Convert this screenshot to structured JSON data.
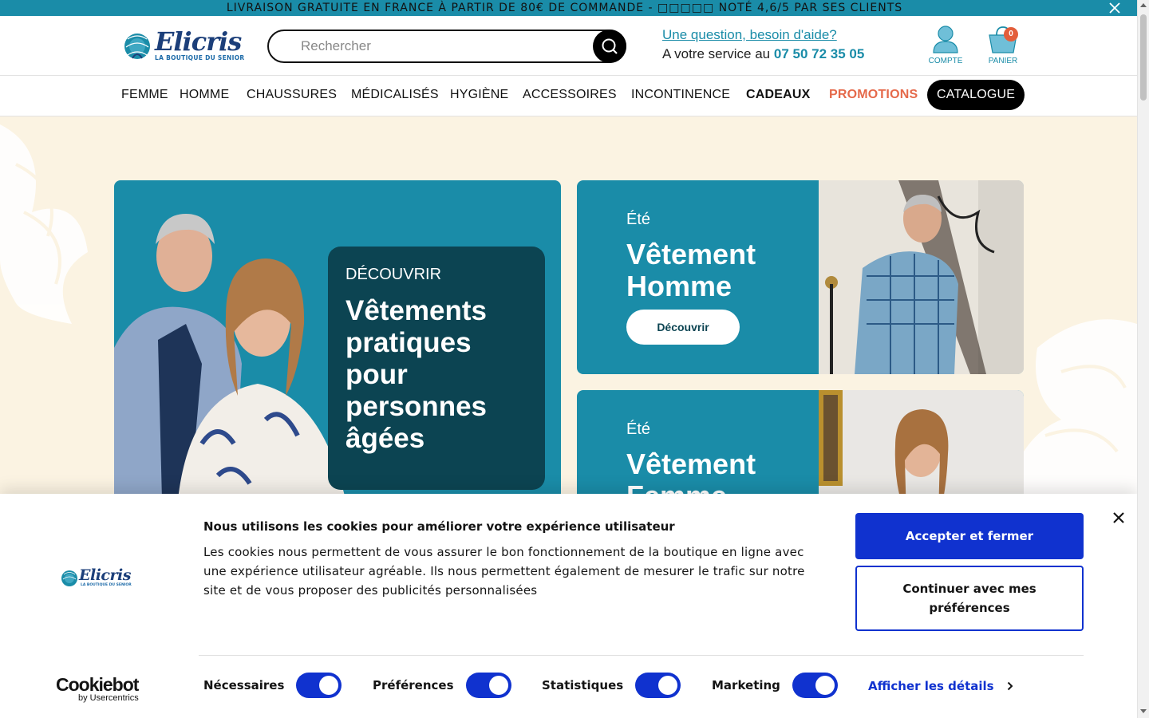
{
  "announcement": {
    "text": "LIVRAISON GRATUITE EN FRANCE À PARTIR DE 80€ DE COMMANDE  - □□□□□ NOTÉ 4,6/5 PAR SES CLIENTS"
  },
  "logo": {
    "name": "Elicris",
    "tagline": "LA BOUTIQUE DU SENIOR"
  },
  "search": {
    "placeholder": "Rechercher"
  },
  "help": {
    "question": "Une question, besoin d'aide?",
    "service_prefix": "A votre service au",
    "phone": "07 50 72 35 05"
  },
  "account": {
    "label": "COMPTE"
  },
  "cart": {
    "label": "PANIER",
    "count": "0"
  },
  "nav": {
    "items": [
      "FEMME",
      "HOMME",
      "CHAUSSURES",
      "MÉDICALISÉS",
      "HYGIÈNE",
      "ACCESSOIRES",
      "INCONTINENCE",
      "CADEAUX",
      "PROMOTIONS",
      "CATALOGUE"
    ]
  },
  "hero": {
    "main": {
      "eyebrow": "DÉCOUVRIR",
      "title": "Vêtements pratiques pour personnes âgées"
    },
    "cards": [
      {
        "eyebrow": "Été",
        "title": "Vêtement Homme",
        "cta": "Découvrir"
      },
      {
        "eyebrow": "Été",
        "title": "Vêtement Femme"
      }
    ]
  },
  "cookie": {
    "heading": "Nous utilisons les cookies pour améliorer votre expérience utilisateur",
    "body": "Les cookies nous permettent de vous assurer le bon fonctionnement de la boutique en ligne avec une expérience utilisateur agréable. Ils nous permettent également de mesurer le trafic sur notre site et de vous proposer des publicités personnalisées",
    "accept": "Accepter et fermer",
    "preferences": "Continuer avec mes préférences",
    "toggles": [
      {
        "label": "Nécessaires",
        "on": true
      },
      {
        "label": "Préférences",
        "on": true
      },
      {
        "label": "Statistiques",
        "on": true
      },
      {
        "label": "Marketing",
        "on": true
      }
    ],
    "details": "Afficher les détails",
    "brand": "Cookiebot",
    "brand_sub": "by Usercentrics"
  },
  "colors": {
    "accent": "#1a8ca8",
    "dark_teal": "#0c4452",
    "promo": "#e5694a",
    "cookie_blue": "#1032cf",
    "hero_bg": "#fbf3e2"
  }
}
